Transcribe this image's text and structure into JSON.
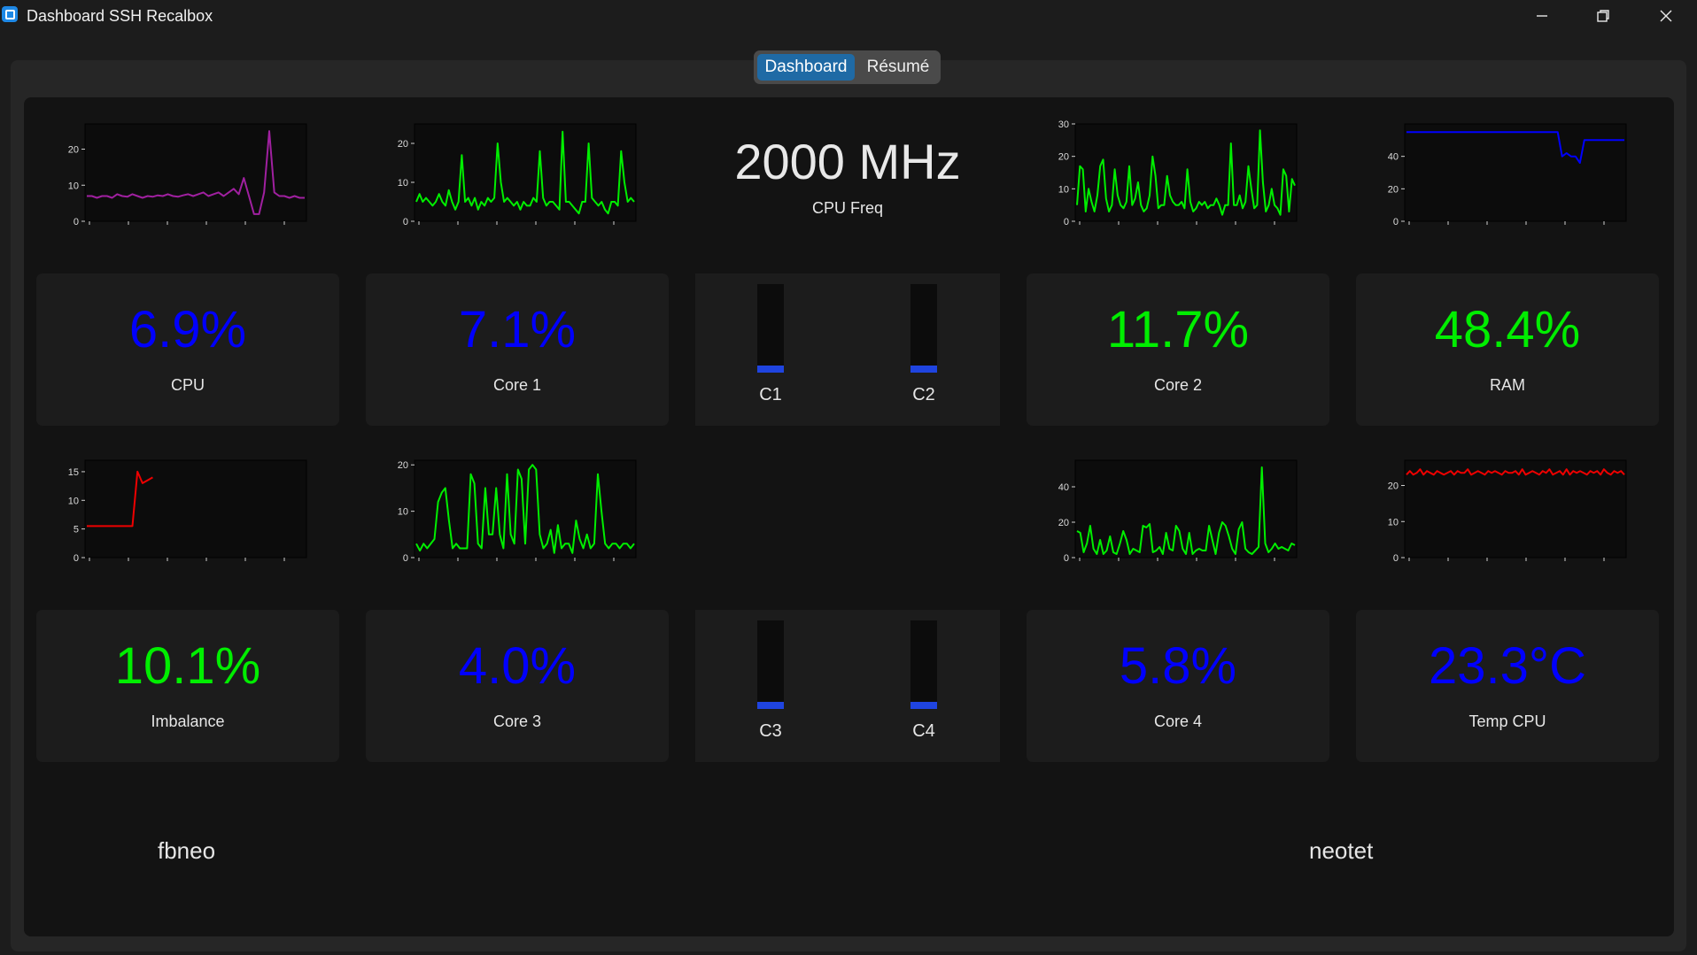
{
  "window": {
    "title": "Dashboard SSH Recalbox"
  },
  "tabs": {
    "dashboard": "Dashboard",
    "resume": "Résumé"
  },
  "colors": {
    "blue": "#0000ff",
    "green": "#00ee00",
    "purple": "#a020a0",
    "red": "#ee0000",
    "tab_active": "#1f6aa5"
  },
  "freq": {
    "value": "2000 MHz",
    "label": "CPU Freq"
  },
  "cards": [
    {
      "value": "6.9%",
      "label": "CPU",
      "color": "#0000ff"
    },
    {
      "value": "7.1%",
      "label": "Core 1",
      "color": "#0000ff"
    },
    {
      "value": "11.7%",
      "label": "Core 2",
      "color": "#00ee00"
    },
    {
      "value": "48.4%",
      "label": "RAM",
      "color": "#00ee00"
    },
    {
      "value": "10.1%",
      "label": "Imbalance",
      "color": "#00ee00"
    },
    {
      "value": "4.0%",
      "label": "Core 3",
      "color": "#0000ff"
    },
    {
      "value": "5.8%",
      "label": "Core 4",
      "color": "#0000ff"
    },
    {
      "value": "23.3°C",
      "label": "Temp CPU",
      "color": "#0000ff"
    }
  ],
  "bars": [
    {
      "label": "C1",
      "fraction": 0.07
    },
    {
      "label": "C2",
      "fraction": 0.07
    },
    {
      "label": "C3",
      "fraction": 0.04
    },
    {
      "label": "C4",
      "fraction": 0.06
    }
  ],
  "footer": {
    "left": "fbneo",
    "right": "neotet"
  },
  "chart_data": [
    {
      "type": "line",
      "color": "#a020a0",
      "ylim": [
        0,
        27
      ],
      "yticks": [
        "0",
        "10",
        "20"
      ],
      "series": [
        {
          "values": [
            7,
            7,
            6.5,
            7,
            7,
            6.5,
            7.5,
            7,
            6.8,
            7.5,
            7,
            6.5,
            7,
            6.8,
            7.2,
            7,
            7.5,
            7,
            6.8,
            7.2,
            7.5,
            7,
            7.5,
            8,
            7,
            7.5,
            8,
            7,
            8,
            9,
            7.5,
            12,
            7,
            2,
            2,
            8,
            25,
            8,
            7,
            7,
            6.5,
            7,
            6.5,
            6.5
          ]
        }
      ]
    },
    {
      "type": "line",
      "color": "#00ee00",
      "ylim": [
        0,
        25
      ],
      "yticks": [
        "0",
        "10",
        "20"
      ],
      "series": [
        {
          "values": [
            5,
            7,
            5,
            6,
            5,
            4,
            5,
            7,
            5,
            4,
            8,
            5,
            3,
            5,
            17,
            5,
            6,
            4,
            6,
            3,
            5,
            4,
            6,
            5,
            6,
            20,
            10,
            5,
            6,
            5,
            4,
            5,
            3,
            5,
            4,
            4,
            6,
            5,
            18,
            6,
            4,
            5,
            5,
            4,
            3,
            23,
            5,
            5,
            4,
            3,
            2,
            5,
            5,
            20,
            6,
            5,
            4,
            5,
            3,
            2,
            5,
            5,
            4,
            18,
            10,
            5,
            6,
            5
          ]
        }
      ]
    },
    {
      "type": "line",
      "color": "#00ee00",
      "ylim": [
        0,
        30
      ],
      "yticks": [
        "0",
        "10",
        "20",
        "30"
      ],
      "series": [
        {
          "values": [
            5,
            17,
            16,
            3,
            10,
            6,
            3,
            8,
            17,
            19,
            7,
            3,
            5,
            16,
            8,
            5,
            4,
            6,
            17,
            5,
            7,
            12,
            5,
            3,
            4,
            8,
            20,
            14,
            4,
            5,
            5,
            14,
            8,
            6,
            5,
            5,
            6,
            4,
            16,
            6,
            3,
            4,
            6,
            5,
            6,
            4,
            5,
            5,
            7,
            5,
            2,
            5,
            5,
            24,
            5,
            5,
            8,
            4,
            6,
            17,
            10,
            4,
            5,
            28,
            12,
            3,
            5,
            10,
            5,
            4,
            2,
            16,
            14,
            3,
            13,
            11
          ]
        }
      ]
    },
    {
      "type": "line",
      "color": "#0000ff",
      "ylim": [
        0,
        60
      ],
      "yticks": [
        "0",
        "20",
        "40"
      ],
      "series": [
        {
          "values": [
            55,
            55,
            55,
            55,
            55,
            55,
            55,
            55,
            55,
            55,
            55,
            55,
            55,
            55,
            55,
            55,
            55,
            55,
            55,
            55,
            55,
            55,
            55,
            55,
            55,
            55,
            55,
            55,
            55,
            55,
            55,
            55,
            55,
            55,
            55,
            40,
            42,
            40,
            40,
            36,
            50,
            50,
            50,
            50,
            50,
            50,
            50,
            50,
            50,
            50
          ]
        }
      ]
    },
    {
      "type": "line",
      "color": "#ee0000",
      "ylim": [
        0,
        17
      ],
      "yticks": [
        "0",
        "5",
        "10",
        "15"
      ],
      "series": [
        {
          "values": [
            5.5,
            5.5,
            5.5,
            5.5,
            5.5,
            5.5,
            5.5,
            5.5,
            5.5,
            5.5,
            15,
            13,
            13.5,
            14
          ]
        }
      ],
      "x_capacity": 44
    },
    {
      "type": "line",
      "color": "#00ee00",
      "ylim": [
        0,
        21
      ],
      "yticks": [
        "0",
        "10",
        "20"
      ],
      "series": [
        {
          "values": [
            3,
            1.5,
            3,
            2,
            3,
            4,
            12,
            14,
            15,
            8,
            2,
            3,
            2,
            2,
            2,
            18,
            16,
            3,
            2,
            15,
            5,
            5,
            15,
            5,
            2,
            18,
            5,
            3,
            19,
            17,
            3,
            19,
            20,
            19,
            5,
            2,
            3,
            6,
            1,
            7,
            2,
            3,
            3,
            1,
            8,
            4,
            2,
            5,
            2,
            3,
            18,
            10,
            3,
            2,
            3,
            3,
            2,
            3,
            3,
            2,
            3
          ]
        }
      ]
    },
    {
      "type": "line",
      "color": "#00ee00",
      "ylim": [
        0,
        55
      ],
      "yticks": [
        "0",
        "20",
        "40"
      ],
      "series": [
        {
          "values": [
            15,
            14,
            3,
            8,
            18,
            5,
            2,
            10,
            2,
            4,
            12,
            3,
            2,
            8,
            15,
            10,
            2,
            5,
            4,
            3,
            18,
            17,
            19,
            3,
            4,
            6,
            2,
            14,
            5,
            4,
            18,
            15,
            5,
            2,
            14,
            2,
            4,
            5,
            4,
            4,
            18,
            10,
            2,
            14,
            20,
            18,
            12,
            5,
            2,
            16,
            20,
            5,
            3,
            2,
            4,
            6,
            51,
            8,
            3,
            5,
            8,
            5,
            6,
            5,
            4,
            8,
            7
          ]
        }
      ]
    },
    {
      "type": "line",
      "color": "#ee0000",
      "ylim": [
        0,
        27
      ],
      "yticks": [
        "0",
        "10",
        "20"
      ],
      "series": [
        {
          "values": [
            23,
            24,
            23,
            23.5,
            24.5,
            23,
            24,
            23.5,
            23,
            24,
            23.5,
            23,
            23.5,
            24,
            23,
            24,
            23.5,
            23.5,
            24.5,
            23,
            23.5,
            24,
            23.5,
            23,
            24,
            23.5,
            24,
            23.5,
            23,
            24,
            23.5,
            23.5,
            24,
            23,
            24.5,
            23,
            23.5,
            24,
            23.5,
            23,
            24,
            23.5,
            24.5,
            23,
            23.5,
            24,
            23,
            24.5,
            23,
            24,
            23.5,
            24,
            23.5,
            23,
            24,
            23.5,
            24,
            23,
            24.5,
            23.5,
            23,
            24,
            23.5,
            24,
            23
          ]
        }
      ]
    }
  ]
}
